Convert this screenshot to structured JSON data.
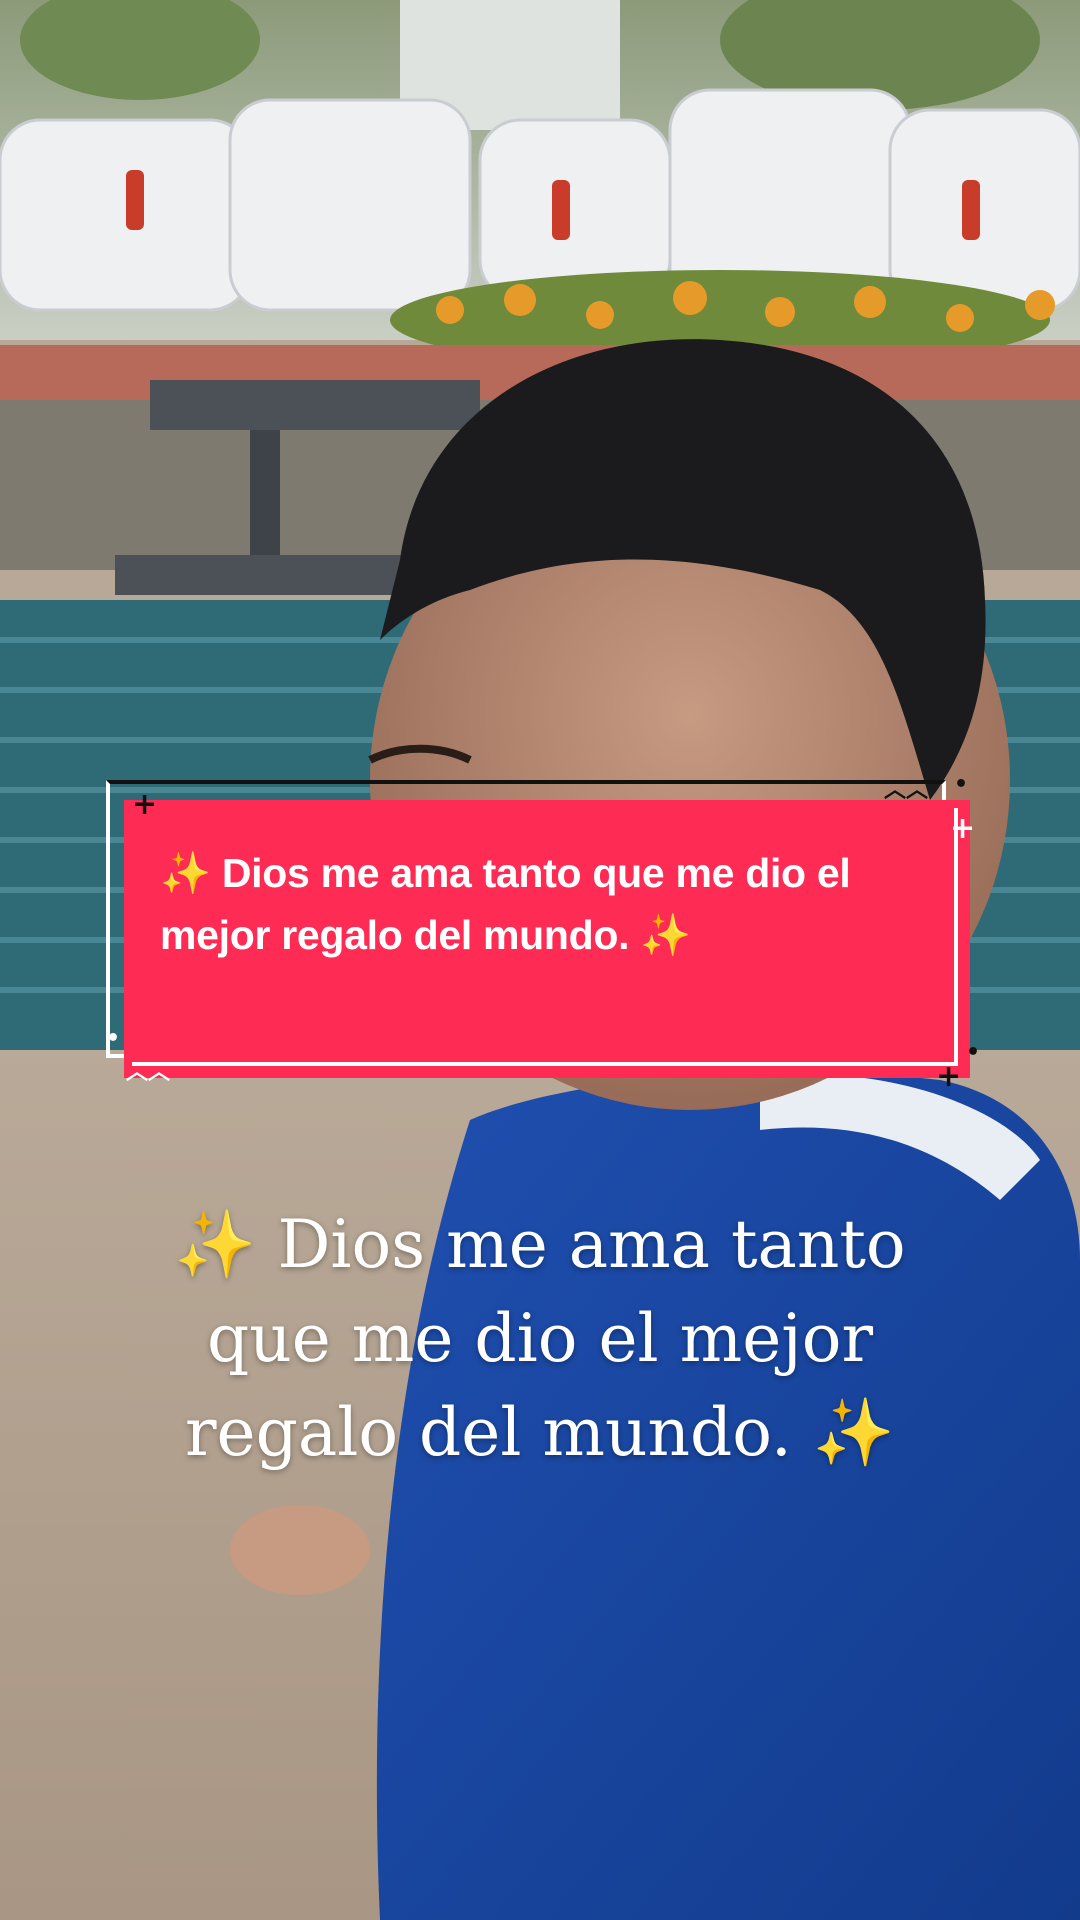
{
  "sticker": {
    "text": "✨ Dios me ama tanto que me dio el mejor regalo del mundo. ✨",
    "fill_color": "#fe2c55"
  },
  "overlay": {
    "line1": "✨ Dios me ama tanto",
    "line2": "que me dio el mejor",
    "line3": "regalo del mundo. ✨"
  }
}
